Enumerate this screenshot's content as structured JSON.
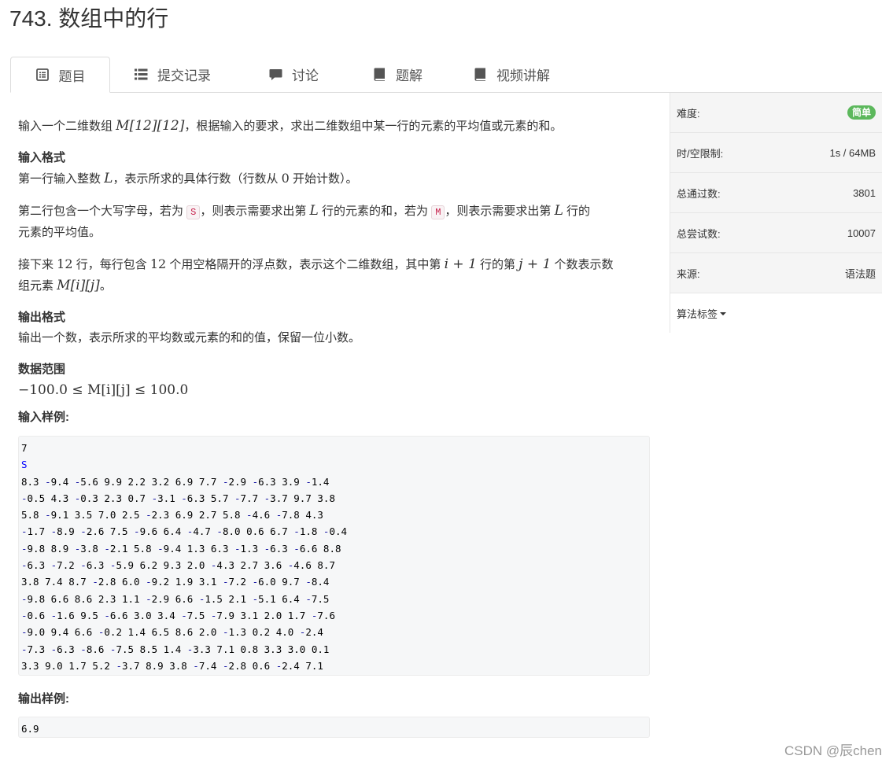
{
  "page_title": "743. 数组中的行",
  "tabs": [
    {
      "label": "题目",
      "icon": "list-alt-icon",
      "active": true
    },
    {
      "label": "提交记录",
      "icon": "list-icon"
    },
    {
      "label": "讨论",
      "icon": "comment-icon"
    },
    {
      "label": "题解",
      "icon": "book-icon"
    },
    {
      "label": "视频讲解",
      "icon": "book-icon"
    }
  ],
  "problem": {
    "intro_prefix": "输入一个二维数组 ",
    "intro_matrix": "M[12][12]",
    "intro_suffix": "，根据输入的要求，求出二维数组中某一行的元素的平均值或元素的和。",
    "input_heading": "输入格式",
    "line1_prefix": "第一行输入整数 ",
    "line1_var": "L",
    "line1_mid": "，表示所求的具体行数（行数从 ",
    "line1_zero": "0",
    "line1_suffix": " 开始计数）。",
    "line2_p1": "第二行包含一个大写字母，若为 ",
    "line2_code_s": "S",
    "line2_p2": "，则表示需要求出第 ",
    "line2_var1": "L",
    "line2_p3": " 行的元素的和，若为 ",
    "line2_code_m": "M",
    "line2_p4": "，则表示需要求出第 ",
    "line2_var2": "L",
    "line2_p5": " 行的",
    "line2_p6": "元素的平均值。",
    "line3_p1": "接下来 ",
    "line3_n1": "12",
    "line3_p2": " 行，每行包含 ",
    "line3_n2": "12",
    "line3_p3": " 个用空格隔开的浮点数，表示这个二维数组，其中第 ",
    "line3_m1": "i + 1",
    "line3_p4": " 行的第 ",
    "line3_m2": "j + 1",
    "line3_p5": " 个数表示数",
    "line3_p6": "组元素 ",
    "line3_m3": "M[i][j]",
    "line3_p7": "。",
    "output_heading": "输出格式",
    "output_desc": "输出一个数，表示所求的平均数或元素的和的值，保留一位小数。",
    "range_heading": "数据范围",
    "range_formula": "−100.0 ≤ M[i][j] ≤ 100.0",
    "sample_input_heading": "输入样例:",
    "sample_input": [
      "7",
      "S",
      "8.3 -9.4 -5.6 9.9 2.2 3.2 6.9 7.7 -2.9 -6.3 3.9 -1.4",
      "-0.5 4.3 -0.3 2.3 0.7 -3.1 -6.3 5.7 -7.7 -3.7 9.7 3.8",
      "5.8 -9.1 3.5 7.0 2.5 -2.3 6.9 2.7 5.8 -4.6 -7.8 4.3",
      "-1.7 -8.9 -2.6 7.5 -9.6 6.4 -4.7 -8.0 0.6 6.7 -1.8 -0.4",
      "-9.8 8.9 -3.8 -2.1 5.8 -9.4 1.3 6.3 -1.3 -6.3 -6.6 8.8",
      "-6.3 -7.2 -6.3 -5.9 6.2 9.3 2.0 -4.3 2.7 3.6 -4.6 8.7",
      "3.8 7.4 8.7 -2.8 6.0 -9.2 1.9 3.1 -7.2 -6.0 9.7 -8.4",
      "-9.8 6.6 8.6 2.3 1.1 -2.9 6.6 -1.5 2.1 -5.1 6.4 -7.5",
      "-0.6 -1.6 9.5 -6.6 3.0 3.4 -7.5 -7.9 3.1 2.0 1.7 -7.6",
      "-9.0 9.4 6.6 -0.2 1.4 6.5 8.6 2.0 -1.3 0.2 4.0 -2.4",
      "-7.3 -6.3 -8.6 -7.5 8.5 1.4 -3.3 7.1 0.8 3.3 3.0 0.1",
      "3.3 9.0 1.7 5.2 -3.7 8.9 3.8 -7.4 -2.8 0.6 -2.4 7.1"
    ],
    "sample_output_heading": "输出样例:",
    "sample_output": "6.9"
  },
  "sidebar": {
    "difficulty_label": "难度:",
    "difficulty_value": "简单",
    "limits_label": "时/空限制:",
    "limits_value": "1s / 64MB",
    "passed_label": "总通过数:",
    "passed_value": "3801",
    "attempts_label": "总尝试数:",
    "attempts_value": "10007",
    "source_label": "来源:",
    "source_value": "语法题",
    "tags_label": "算法标签"
  },
  "watermark": "CSDN @辰chen",
  "colors": {
    "badge": "#5cb85c",
    "negative_number": "#1a1aa6",
    "inline_code": "#c7254e"
  }
}
